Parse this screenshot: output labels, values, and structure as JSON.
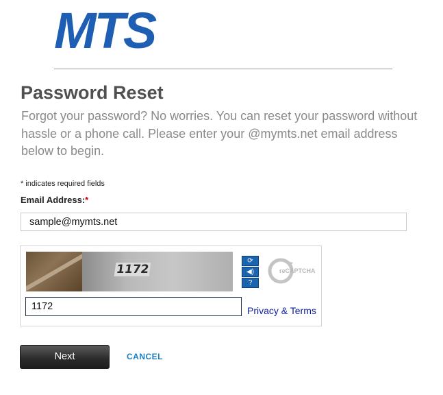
{
  "brand": {
    "logo_text": "MTS",
    "logo_color": "#1e5fb3"
  },
  "page": {
    "title": "Password Reset",
    "intro": "Forgot your password? No worries. You can reset your password without hassle or a phone call. Please enter your @mymts.net email address below to begin."
  },
  "form": {
    "required_note": "* indicates required fields",
    "email_label": "Email Address:",
    "required_marker": "*",
    "email_value": "sample@mymts.net"
  },
  "captcha": {
    "image_number": "1172",
    "response_value": "1172",
    "privacy_link": "Privacy & Terms",
    "brand_text": "reCAPTCHA",
    "buttons": [
      {
        "icon": "refresh-icon",
        "glyph": "⟳"
      },
      {
        "icon": "audio-icon",
        "glyph": "◀)"
      },
      {
        "icon": "help-icon",
        "glyph": "?"
      }
    ]
  },
  "actions": {
    "next_label": "Next",
    "cancel_label": "CANCEL"
  }
}
